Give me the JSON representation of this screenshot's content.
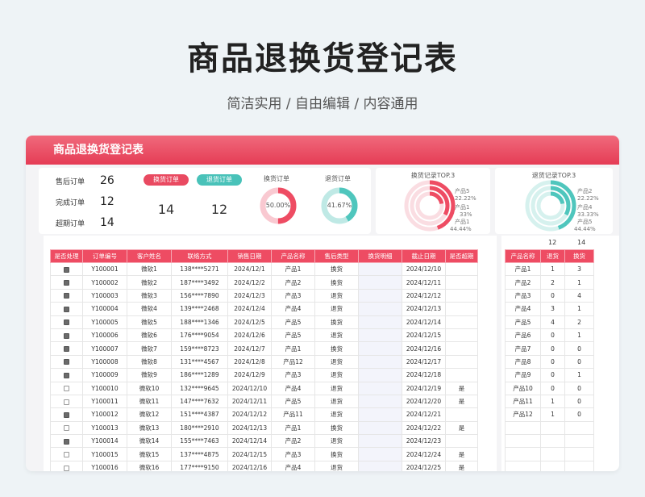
{
  "page": {
    "title": "商品退换货登记表",
    "subtitle": "简洁实用 / 自由编辑 / 内容通用"
  },
  "sheet": {
    "title": "商品退换货登记表"
  },
  "counts": [
    {
      "label": "售后订单",
      "value": "26"
    },
    {
      "label": "完成订单",
      "value": "12"
    },
    {
      "label": "超期订单",
      "value": "14"
    }
  ],
  "pills": {
    "exchange": "换货订单",
    "refund": "退货订单"
  },
  "totals": {
    "exchange": "14",
    "refund": "12"
  },
  "donuts": {
    "exchange": {
      "title": "换货订单",
      "value": 50.0,
      "label": "50.00%",
      "color": "#ee4c63",
      "track": "#f9c9d1"
    },
    "refund": {
      "title": "退货订单",
      "value": 41.67,
      "label": "41.67%",
      "color": "#4fc6bd",
      "track": "#bfe9e5"
    }
  },
  "top3": {
    "exchange": {
      "title": "换货记录TOP.3",
      "items": [
        {
          "name": "产品5",
          "pct": "22.22%"
        },
        {
          "name": "产品1",
          "pct": "33%"
        },
        {
          "name": "产品1",
          "pct": "44.44%"
        }
      ]
    },
    "refund": {
      "title": "退货记录TOP.3",
      "items": [
        {
          "name": "产品2",
          "pct": "22.22%"
        },
        {
          "name": "产品4",
          "pct": "33.33%"
        },
        {
          "name": "产品5",
          "pct": "44.44%"
        }
      ]
    }
  },
  "table": {
    "headers": [
      "是否处理",
      "订单编号",
      "客户姓名",
      "联络方式",
      "销售日期",
      "产品名称",
      "售后类型",
      "换货明细",
      "截止日期",
      "是否超期"
    ],
    "rows": [
      {
        "done": true,
        "id": "Y100001",
        "name": "微软1",
        "phone": "138****5271",
        "date": "2024/12/1",
        "product": "产品1",
        "type": "换货",
        "detail": "",
        "due": "2024/12/10",
        "overdue": ""
      },
      {
        "done": true,
        "id": "Y100002",
        "name": "微软2",
        "phone": "187****3492",
        "date": "2024/12/2",
        "product": "产品2",
        "type": "换货",
        "detail": "",
        "due": "2024/12/11",
        "overdue": ""
      },
      {
        "done": true,
        "id": "Y100003",
        "name": "微软3",
        "phone": "156****7890",
        "date": "2024/12/3",
        "product": "产品3",
        "type": "退货",
        "detail": "",
        "due": "2024/12/12",
        "overdue": ""
      },
      {
        "done": true,
        "id": "Y100004",
        "name": "微软4",
        "phone": "139****2468",
        "date": "2024/12/4",
        "product": "产品4",
        "type": "退货",
        "detail": "",
        "due": "2024/12/13",
        "overdue": ""
      },
      {
        "done": true,
        "id": "Y100005",
        "name": "微软5",
        "phone": "188****1346",
        "date": "2024/12/5",
        "product": "产品5",
        "type": "换货",
        "detail": "",
        "due": "2024/12/14",
        "overdue": ""
      },
      {
        "done": true,
        "id": "Y100006",
        "name": "微软6",
        "phone": "176****9054",
        "date": "2024/12/6",
        "product": "产品5",
        "type": "退货",
        "detail": "",
        "due": "2024/12/15",
        "overdue": ""
      },
      {
        "done": true,
        "id": "Y100007",
        "name": "微软7",
        "phone": "159****8723",
        "date": "2024/12/7",
        "product": "产品1",
        "type": "换货",
        "detail": "",
        "due": "2024/12/16",
        "overdue": ""
      },
      {
        "done": true,
        "id": "Y100008",
        "name": "微软8",
        "phone": "131****4567",
        "date": "2024/12/8",
        "product": "产品12",
        "type": "退货",
        "detail": "",
        "due": "2024/12/17",
        "overdue": ""
      },
      {
        "done": true,
        "id": "Y100009",
        "name": "微软9",
        "phone": "186****1289",
        "date": "2024/12/9",
        "product": "产品3",
        "type": "退货",
        "detail": "",
        "due": "2024/12/18",
        "overdue": ""
      },
      {
        "done": false,
        "id": "Y100010",
        "name": "微软10",
        "phone": "132****9645",
        "date": "2024/12/10",
        "product": "产品4",
        "type": "退货",
        "detail": "",
        "due": "2024/12/19",
        "overdue": "是"
      },
      {
        "done": false,
        "id": "Y100011",
        "name": "微软11",
        "phone": "147****7632",
        "date": "2024/12/11",
        "product": "产品5",
        "type": "退货",
        "detail": "",
        "due": "2024/12/20",
        "overdue": "是"
      },
      {
        "done": true,
        "id": "Y100012",
        "name": "微软12",
        "phone": "151****4387",
        "date": "2024/12/12",
        "product": "产品11",
        "type": "退货",
        "detail": "",
        "due": "2024/12/21",
        "overdue": ""
      },
      {
        "done": false,
        "id": "Y100013",
        "name": "微软13",
        "phone": "180****2910",
        "date": "2024/12/13",
        "product": "产品1",
        "type": "换货",
        "detail": "",
        "due": "2024/12/22",
        "overdue": "是"
      },
      {
        "done": true,
        "id": "Y100014",
        "name": "微软14",
        "phone": "155****7463",
        "date": "2024/12/14",
        "product": "产品2",
        "type": "退货",
        "detail": "",
        "due": "2024/12/23",
        "overdue": ""
      },
      {
        "done": false,
        "id": "Y100015",
        "name": "微软15",
        "phone": "137****4875",
        "date": "2024/12/15",
        "product": "产品3",
        "type": "换货",
        "detail": "",
        "due": "2024/12/24",
        "overdue": "是"
      },
      {
        "done": false,
        "id": "Y100016",
        "name": "微软16",
        "phone": "177****9150",
        "date": "2024/12/16",
        "product": "产品4",
        "type": "退货",
        "detail": "",
        "due": "2024/12/25",
        "overdue": "是"
      }
    ]
  },
  "side": {
    "top": {
      "refund_total": "12",
      "exchange_total": "14"
    },
    "headers": [
      "产品名称",
      "退货",
      "换货"
    ],
    "rows": [
      {
        "name": "产品1",
        "refund": "1",
        "exchange": "3"
      },
      {
        "name": "产品2",
        "refund": "2",
        "exchange": "1"
      },
      {
        "name": "产品3",
        "refund": "0",
        "exchange": "4"
      },
      {
        "name": "产品4",
        "refund": "3",
        "exchange": "1"
      },
      {
        "name": "产品5",
        "refund": "4",
        "exchange": "2"
      },
      {
        "name": "产品6",
        "refund": "0",
        "exchange": "1"
      },
      {
        "name": "产品7",
        "refund": "0",
        "exchange": "0"
      },
      {
        "name": "产品8",
        "refund": "0",
        "exchange": "0"
      },
      {
        "name": "产品9",
        "refund": "0",
        "exchange": "1"
      },
      {
        "name": "产品10",
        "refund": "0",
        "exchange": "0"
      },
      {
        "name": "产品11",
        "refund": "1",
        "exchange": "0"
      },
      {
        "name": "产品12",
        "refund": "1",
        "exchange": "0"
      },
      {
        "name": "",
        "refund": "",
        "exchange": ""
      },
      {
        "name": "",
        "refund": "",
        "exchange": ""
      },
      {
        "name": "",
        "refund": "",
        "exchange": ""
      },
      {
        "name": "",
        "refund": "",
        "exchange": ""
      }
    ]
  }
}
